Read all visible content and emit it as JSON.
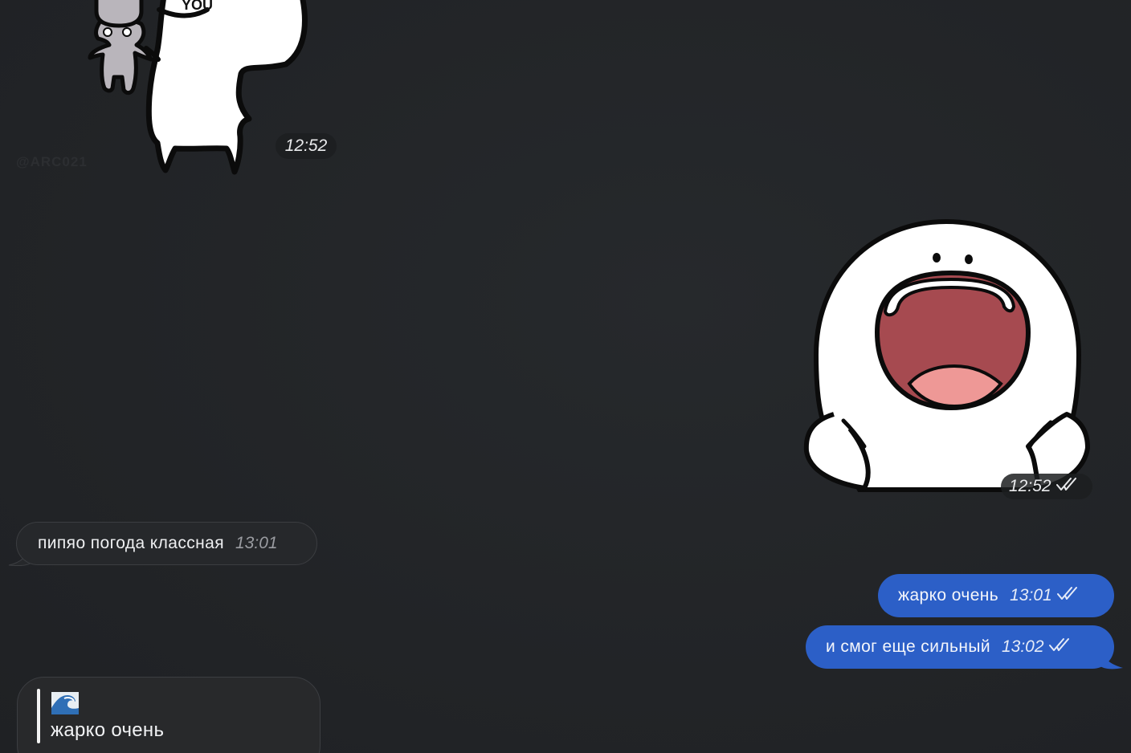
{
  "messages": {
    "sticker_in": {
      "time": "12:52",
      "badge": "YOU",
      "watermark": "@ARC021"
    },
    "sticker_out": {
      "time": "12:52",
      "status": "read"
    },
    "msg1": {
      "text": "пипяо погода классная",
      "time": "13:01",
      "direction": "incoming"
    },
    "msg2": {
      "text": "жарко очень",
      "time": "13:01",
      "direction": "outgoing",
      "status": "read"
    },
    "msg3": {
      "text": "и смог еще сильный",
      "time": "13:02",
      "direction": "outgoing",
      "status": "read"
    },
    "reply": {
      "emoji_icon": "wave-emoji-icon",
      "quote_text": "жарко очень"
    }
  },
  "colors": {
    "background": "#232528",
    "outgoing_bubble": "#2c5fc7",
    "incoming_bubble": "#26282b"
  }
}
